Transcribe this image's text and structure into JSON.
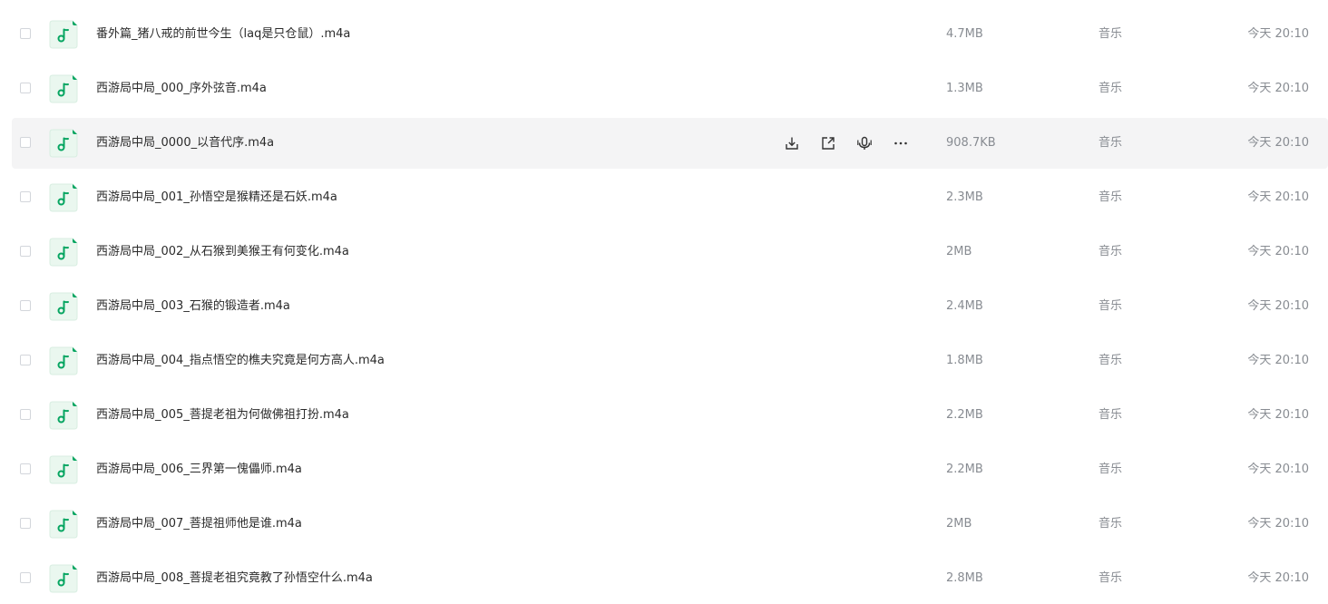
{
  "file_list": {
    "accent_color": "#06a561",
    "icon_bg_color": "#eaf7ef",
    "row_hover_color": "#f4f4f5",
    "hovered_row_index": 2,
    "row_actions": [
      {
        "name": "download-icon",
        "label": "download"
      },
      {
        "name": "share-icon",
        "label": "share"
      },
      {
        "name": "audio-play-icon",
        "label": "play"
      },
      {
        "name": "more-icon",
        "label": "more"
      }
    ],
    "rows": [
      {
        "name": "番外篇_猪八戒的前世今生（laq是只仓鼠）.m4a",
        "size": "4.7MB",
        "type": "音乐",
        "time": "今天 20:10",
        "icon": "music-note-icon"
      },
      {
        "name": "西游局中局_000_序外弦音.m4a",
        "size": "1.3MB",
        "type": "音乐",
        "time": "今天 20:10",
        "icon": "music-note-icon"
      },
      {
        "name": "西游局中局_0000_以音代序.m4a",
        "size": "908.7KB",
        "type": "音乐",
        "time": "今天 20:10",
        "icon": "music-note-icon"
      },
      {
        "name": "西游局中局_001_孙悟空是猴精还是石妖.m4a",
        "size": "2.3MB",
        "type": "音乐",
        "time": "今天 20:10",
        "icon": "music-note-icon"
      },
      {
        "name": "西游局中局_002_从石猴到美猴王有何变化.m4a",
        "size": "2MB",
        "type": "音乐",
        "time": "今天 20:10",
        "icon": "music-note-icon"
      },
      {
        "name": "西游局中局_003_石猴的锻造者.m4a",
        "size": "2.4MB",
        "type": "音乐",
        "time": "今天 20:10",
        "icon": "music-note-icon"
      },
      {
        "name": "西游局中局_004_指点悟空的樵夫究竟是何方高人.m4a",
        "size": "1.8MB",
        "type": "音乐",
        "time": "今天 20:10",
        "icon": "music-note-icon"
      },
      {
        "name": "西游局中局_005_菩提老祖为何做佛祖打扮.m4a",
        "size": "2.2MB",
        "type": "音乐",
        "time": "今天 20:10",
        "icon": "music-note-icon"
      },
      {
        "name": "西游局中局_006_三界第一傀儡师.m4a",
        "size": "2.2MB",
        "type": "音乐",
        "time": "今天 20:10",
        "icon": "music-note-icon"
      },
      {
        "name": "西游局中局_007_菩提祖师他是谁.m4a",
        "size": "2MB",
        "type": "音乐",
        "time": "今天 20:10",
        "icon": "music-note-icon"
      },
      {
        "name": "西游局中局_008_菩提老祖究竟教了孙悟空什么.m4a",
        "size": "2.8MB",
        "type": "音乐",
        "time": "今天 20:10",
        "icon": "music-note-icon"
      }
    ]
  }
}
